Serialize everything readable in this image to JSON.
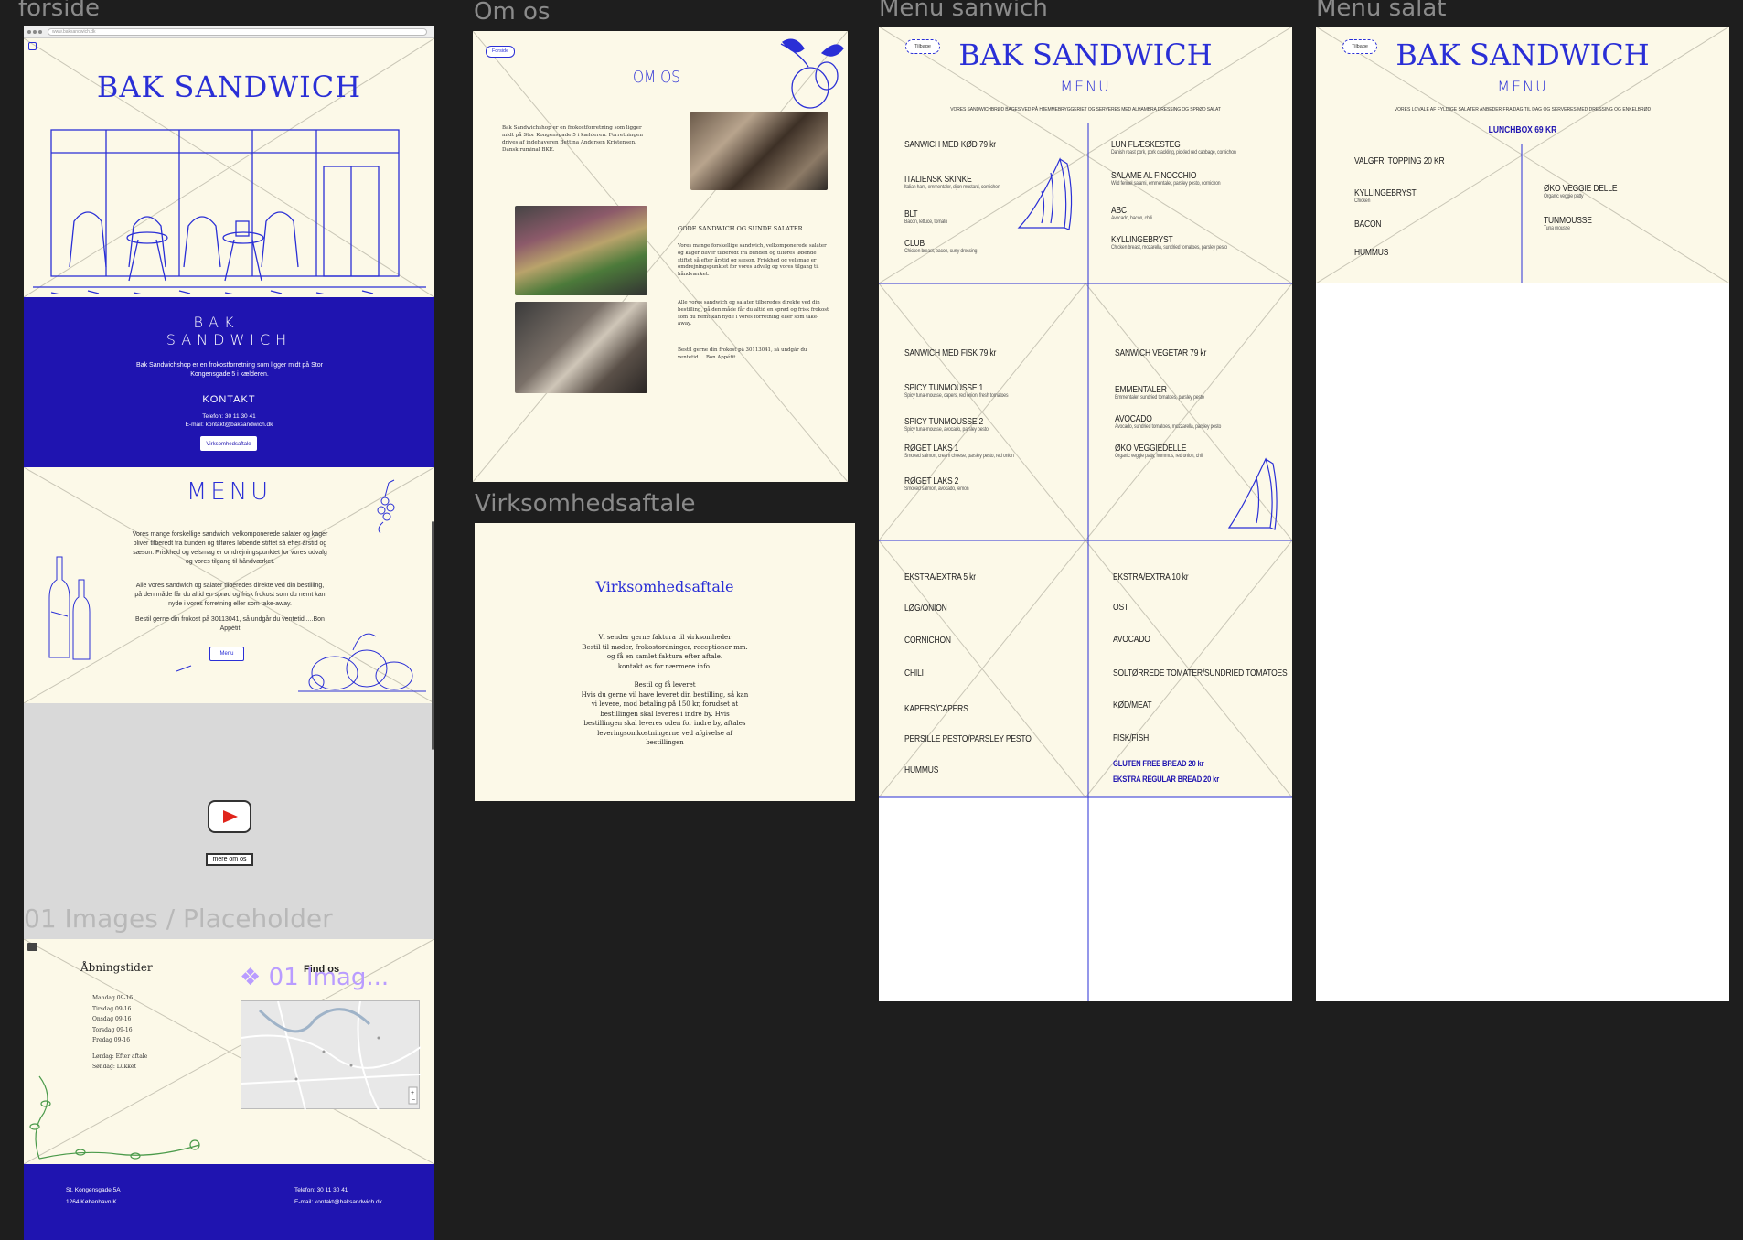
{
  "frames": {
    "forside": "forside",
    "om_os": "Om os",
    "virksomhedsaftale": "Virksomhedsaftale",
    "menu_sandwich": "Menu sanwich",
    "menu_salat": "Menu salat",
    "placeholder": "01 Images / Placeholder"
  },
  "forside": {
    "browser_url": "www.baksandwich.dk",
    "logo": "BAK SANDWICH",
    "blue_block": {
      "brand_line1": "BAK",
      "brand_line2": "SANDWICH",
      "desc": "Bak Sandwichshop er en frokostforretning som ligger midt på Stor Kongensgade 5 i kælderen.",
      "contact_title": "KONTAKT",
      "phone": "Telefon: 30 11 30 41",
      "email": "E-mail: kontakt@baksandwich.dk",
      "button": "Virksomhedsaftale"
    },
    "menu_block": {
      "title": "MENU",
      "p1": "Vores mange forskellige sandwich, velkomponerede salater og kager bliver tilberedt fra bunden og tilføres løbende stiftet så efter årstid og sæson. Friskhed og velsmag er omdrejningspunktet for vores udvalg og vores tilgang til håndværket.",
      "p2": "Alle vores sandwich og salater tilberedes direkte ved din bestilling, på den måde får du altid en sprød og frisk frokost som du nemt kan nyde i vores forretning eller som take-away.",
      "p3": "Bestil gerne din frokost på 30113041, så undgår du ventetid.....Bon Appétit",
      "button": "Menu"
    },
    "video_button": "mere om os",
    "placeholder_label": "01 Images / Placeholder",
    "hours_title": "Åbningstider",
    "hours": [
      "Mandag 09-16",
      "Tirsdag 09-16",
      "Onsdag 09-16",
      "Torsdag 09-16",
      "Fredag 09-16"
    ],
    "hours_extra": [
      "Lørdag: Efter aftale",
      "Søndag: Lukket"
    ],
    "find_title": "Find os",
    "placeholder_chip": "01 Imag...",
    "footer_addr1": "St. Kongensgade 5A",
    "footer_addr2": "1264 København K",
    "footer_phone": "Telefon: 30 11 30 41",
    "footer_email": "E-mail: kontakt@baksandwich.dk"
  },
  "om_os": {
    "back": "Forside",
    "title": "OM OS",
    "intro": "Bak Sandwichshop er en frokostforretning som ligger midt på Stor Kongensgade 5 i kælderen. Forretningen drives af indehaveren Bettina Andersen Kristensen. Dansk ruminal BKE.",
    "section_title": "GODE SANDWICH OG SUNDE SALATER",
    "p1": "Vores mange forskellige sandwich, velkomponerede salater og kager bliver tilberedt fra bunden og tilføres løbende stiftet så efter årstid og sæson. Friskhed og velsmag er omdrejningspunktet for vores udvalg og vores tilgang til håndværket.",
    "p2": "Alle vores sandwich og salater tilberedes direkte ved din bestilling, på den måde får du altid en sprød og frisk frokost som du nemt kan nyde i vores forretning eller som take-away.",
    "p3": "Bestil gerne din frokost på 30113041, så undgår du ventetid.....Bon Appétit"
  },
  "virksomhed": {
    "title": "Virksomhedsaftale",
    "lines": [
      "Vi sender gerne faktura til virksomheder",
      "Bestil til møder, frokostordninger, receptioner mm.",
      "og få en samlet faktura efter aftale.",
      "kontakt os for nærmere info.",
      "",
      "Bestil og få leveret",
      "Hvis du gerne vil have leveret din bestilling, så kan",
      "vi levere, mod betaling på 150 kr, forudset at",
      "bestillingen skal leveres i indre by. Hvis",
      "bestillingen skal leveres uden for indre by, aftales",
      "leveringsomkostningerne ved afgivelse af",
      "bestillingen"
    ]
  },
  "menu_sandwich": {
    "back": "Tilbage",
    "logo": "BAK SANDWICH",
    "menu": "MENU",
    "note": "VORES SANDWICHBRØD BAGES VED PÅ HJEMMEBRYGGERIET OG SERVERES MED ALHAMBRA DRESSING OG SPRØD SALAT",
    "meat_title": "SANWICH MED KØD 79 kr",
    "meat_left": [
      {
        "name": "ITALIENSK SKINKE",
        "sub": "Italian ham, emmentaler, dijon mustard, cornichon"
      },
      {
        "name": "BLT",
        "sub": "Bacon, lettuce, tomato"
      },
      {
        "name": "CLUB",
        "sub": "Chicken breast, bacon, curry dressing"
      }
    ],
    "meat_right": [
      {
        "name": "LUN FLÆSKESTEG",
        "sub": "Danish roast pork, pork crackling, pickled red cabbage, cornichon"
      },
      {
        "name": "SALAME AL FINOCCHIO",
        "sub": "Wild fennel salami, emmentaler, parsley pesto, cornichon"
      },
      {
        "name": "ABC",
        "sub": "Avocado, bacon, chili"
      },
      {
        "name": "KYLLINGEBRYST",
        "sub": "Chicken breast, mozarella, sundried tomatoes, parsley pesto"
      }
    ],
    "fish_title": "SANWICH MED FISK 79 kr",
    "fish": [
      {
        "name": "SPICY TUNMOUSSE 1",
        "sub": "Spicy tuna-mousse, capers, red onion, fresh tomatoes"
      },
      {
        "name": "SPICY TUNMOUSSE 2",
        "sub": "Spicy tuna-mousse, avocado, parsley pesto"
      },
      {
        "name": "RØGET LAKS 1",
        "sub": "Smoked salmon, cream cheese, parsley pesto, red onion"
      },
      {
        "name": "RØGET LAKS 2",
        "sub": "Smoked salmon, avocado, lemon"
      }
    ],
    "veg_title": "SANWICH VEGETAR 79 kr",
    "veg": [
      {
        "name": "EMMENTALER",
        "sub": "Emmentaler, sundried tomatoes, parsley pesto"
      },
      {
        "name": "AVOCADO",
        "sub": "Avocado, sundried tomatoes, mozzarella, parsley pesto"
      },
      {
        "name": "ØKO VEGGIEDELLE",
        "sub": "Organic veggie patty, hummus, red onion, chili"
      }
    ],
    "extra5_title": "EKSTRA/EXTRA 5 kr",
    "extra5": [
      "LØG/ONION",
      "CORNICHON",
      "CHILI",
      "KAPERS/CAPERS",
      "PERSILLE PESTO/PARSLEY PESTO",
      "HUMMUS"
    ],
    "extra10_title": "EKSTRA/EXTRA 10 kr",
    "extra10": [
      "OST",
      "AVOCADO",
      "SOLTØRREDE TOMATER/SUNDRIED TOMATOES",
      "KØD/MEAT",
      "FISK/FISH"
    ],
    "gluten": "GLUTEN FREE BREAD 20 kr",
    "regular": "EKSTRA REGULAR BREAD 20 kr"
  },
  "menu_salat": {
    "back": "Tilbage",
    "logo": "BAK SANDWICH",
    "menu": "MENU",
    "note": "VORES LOVALE AF FYLDIGE SALATER ANBEDER FRA DAG TIL DAG OG SERVERES MED DRESSING OG ENKELBRØD",
    "box": "LUNCHBOX 69 KR",
    "topping": "VALGFRI TOPPING 20 KR",
    "left": [
      {
        "name": "KYLLINGEBRYST",
        "sub": "Chicken"
      },
      {
        "name": "BACON",
        "sub": ""
      },
      {
        "name": "HUMMUS",
        "sub": ""
      }
    ],
    "right": [
      {
        "name": "ØKO VEGGIE DELLE",
        "sub": "Organic veggie patty"
      },
      {
        "name": "TUNMOUSSE",
        "sub": "Tuna mousse"
      }
    ]
  },
  "colors": {
    "brand_blue": "#1f14b0",
    "ink_blue": "#2a2fd6",
    "cream": "#fcf9e8",
    "bg": "#1e1e1e"
  },
  "icons": [
    "play-icon",
    "map-pin-icon",
    "placeholder-diamond-icon"
  ]
}
